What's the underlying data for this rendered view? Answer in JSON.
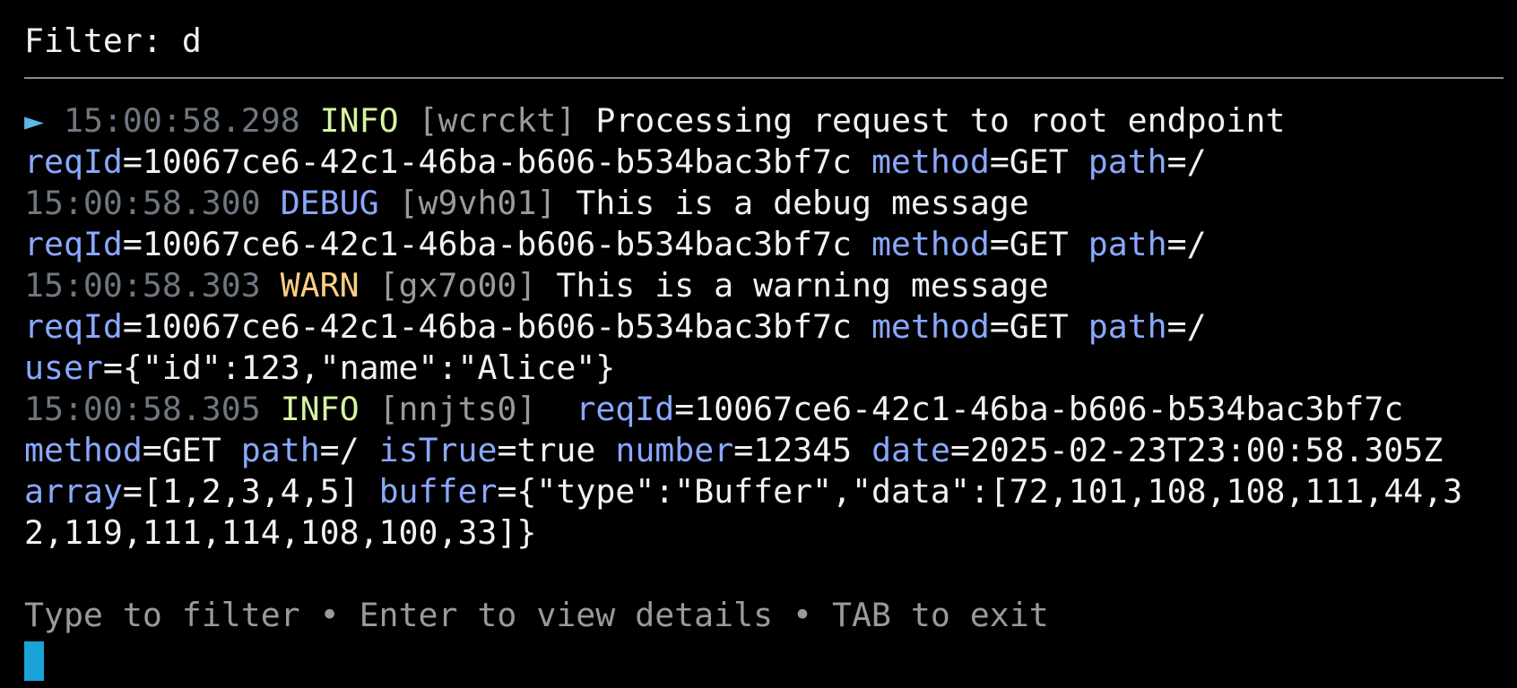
{
  "filter": {
    "label": "Filter: ",
    "value": "d"
  },
  "entries": [
    {
      "selected": true,
      "marker": "►",
      "time": "15:00:58.298",
      "level": "INFO",
      "id": "[wcrckt]",
      "message": "Processing request to root endpoint",
      "fields": [
        {
          "key": "reqId",
          "value": "10067ce6-42c1-46ba-b606-b534bac3bf7c"
        },
        {
          "key": "method",
          "value": "GET"
        },
        {
          "key": "path",
          "value": "/"
        }
      ]
    },
    {
      "time": "15:00:58.300",
      "level": "DEBUG",
      "id": "[w9vh01]",
      "message": "This is a debug message",
      "fields": [
        {
          "key": "reqId",
          "value": "10067ce6-42c1-46ba-b606-b534bac3bf7c"
        },
        {
          "key": "method",
          "value": "GET"
        },
        {
          "key": "path",
          "value": "/"
        }
      ]
    },
    {
      "time": "15:00:58.303",
      "level": "WARN",
      "id": "[gx7o00]",
      "message": "This is a warning message",
      "fields": [
        {
          "key": "reqId",
          "value": "10067ce6-42c1-46ba-b606-b534bac3bf7c"
        },
        {
          "key": "method",
          "value": "GET"
        },
        {
          "key": "path",
          "value": "/"
        },
        {
          "key": "user",
          "value": "{\"id\":123,\"name\":\"Alice\"}"
        }
      ]
    },
    {
      "time": "15:00:58.305",
      "level": "INFO",
      "id": "[nnjts0]",
      "message": "",
      "fields": [
        {
          "key": "reqId",
          "value": "10067ce6-42c1-46ba-b606-b534bac3bf7c"
        },
        {
          "key": "method",
          "value": "GET"
        },
        {
          "key": "path",
          "value": "/"
        },
        {
          "key": "isTrue",
          "value": "true"
        },
        {
          "key": "number",
          "value": "12345"
        },
        {
          "key": "date",
          "value": "2025-02-23T23:00:58.305Z"
        },
        {
          "key": "array",
          "value": "[1,2,3,4,5]"
        },
        {
          "key": "buffer",
          "value": "{\"type\":\"Buffer\",\"data\":[72,101,108,108,111,44,3"
        },
        {
          "key": "",
          "value": "2,119,111,114,108,100,33]}"
        }
      ]
    }
  ],
  "help_text": "Type to filter • Enter to view details • TAB to exit",
  "colors": {
    "background": "#000000",
    "timestamp": "#6e7781",
    "info": "#d6f5a0",
    "debug": "#8aa8ff",
    "warn": "#ffcf80",
    "key": "#8aa8ff",
    "cursor": "#1aa3d9",
    "marker": "#5fb8e6"
  }
}
